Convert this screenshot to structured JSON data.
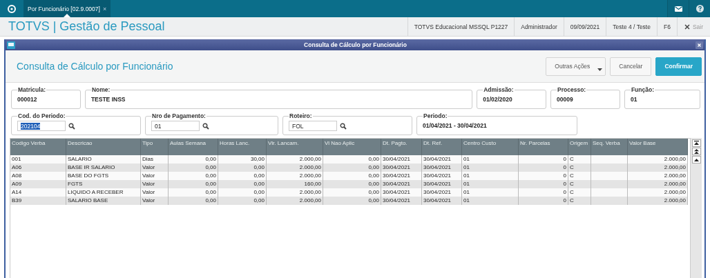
{
  "tabs": [
    {
      "label": "Por Funcionário [02.9.0007]",
      "close": "×",
      "selected": true
    }
  ],
  "app_title": "TOTVS | Gestão de Pessoal",
  "status_items": [
    "TOTVS Educacional MSSQL P1227",
    "Administrador",
    "09/09/2021",
    "Teste 4 / Teste",
    "F6"
  ],
  "exit_label": "Sair",
  "dialog": {
    "title": "Consulta de Cálculo por Funcionário",
    "heading": "Consulta de Cálculo por Funcionário",
    "buttons": [
      {
        "label": "Outras Ações",
        "kind": "menu"
      },
      {
        "label": "Cancelar",
        "kind": "plain"
      },
      {
        "label": "Confirmar",
        "kind": "primary"
      }
    ],
    "fields_row1": [
      {
        "label": "Matricula:",
        "value": "000012",
        "kind": "display"
      },
      {
        "label": "Nome:",
        "value": "TESTE INSS",
        "kind": "display"
      },
      {
        "label": "Admissão:",
        "value": "01/02/2020",
        "kind": "display"
      },
      {
        "label": "Processo:",
        "value": "00009",
        "kind": "display"
      },
      {
        "label": "Função:",
        "value": "01",
        "kind": "display"
      }
    ],
    "fields_row2": [
      {
        "label": "Cod. do Periodo:",
        "value": "202104",
        "kind": "lookup",
        "highlighted": true
      },
      {
        "label": "Nro de Pagamento:",
        "value": "01",
        "kind": "lookup",
        "highlighted": false
      },
      {
        "label": "Roteiro:",
        "value": "FOL",
        "kind": "lookup",
        "highlighted": false
      },
      {
        "label": "Periodo:",
        "value": "01/04/2021 - 30/04/2021",
        "kind": "display"
      }
    ],
    "table": {
      "columns": [
        {
          "label": "Codigo Verba",
          "kind": "text"
        },
        {
          "label": "Descricao",
          "kind": "text"
        },
        {
          "label": "Tipo",
          "kind": "text"
        },
        {
          "label": "Aulas Semana",
          "kind": "number"
        },
        {
          "label": "Horas Lanc.",
          "kind": "number"
        },
        {
          "label": "Vlr. Lancam.",
          "kind": "number"
        },
        {
          "label": "Vl Nao Aplic",
          "kind": "number"
        },
        {
          "label": "Dt. Pagto.",
          "kind": "text"
        },
        {
          "label": "Dt. Ref.",
          "kind": "text"
        },
        {
          "label": "Centro Custo",
          "kind": "text"
        },
        {
          "label": "Nr. Parcelas",
          "kind": "number"
        },
        {
          "label": "Origem",
          "kind": "text"
        },
        {
          "label": "Seq. Verba",
          "kind": "text"
        },
        {
          "label": "Valor Base",
          "kind": "number"
        }
      ],
      "rows": [
        [
          "001",
          "SALARIO",
          "Dias",
          "0,00",
          "30,00",
          "2.000,00",
          "0,00",
          "30/04/2021",
          "30/04/2021",
          "01",
          "0",
          "C",
          "",
          "2.000,00"
        ],
        [
          "A06",
          "BASE IR SALARIO",
          "Valor",
          "0,00",
          "0,00",
          "2.000,00",
          "0,00",
          "30/04/2021",
          "30/04/2021",
          "01",
          "0",
          "C",
          "",
          "2.000,00"
        ],
        [
          "A08",
          "BASE DO FGTS",
          "Valor",
          "0,00",
          "0,00",
          "2.000,00",
          "0,00",
          "30/04/2021",
          "30/04/2021",
          "01",
          "0",
          "C",
          "",
          "2.000,00"
        ],
        [
          "A09",
          "FGTS",
          "Valor",
          "0,00",
          "0,00",
          "160,00",
          "0,00",
          "30/04/2021",
          "30/04/2021",
          "01",
          "0",
          "C",
          "",
          "2.000,00"
        ],
        [
          "A14",
          "LIQUIDO A RECEBER",
          "Valor",
          "0,00",
          "0,00",
          "2.000,00",
          "0,00",
          "30/04/2021",
          "30/04/2021",
          "01",
          "0",
          "C",
          "",
          "2.000,00"
        ],
        [
          "B39",
          "SALARIO BASE",
          "Valor",
          "0,00",
          "0,00",
          "2.000,00",
          "0,00",
          "30/04/2021",
          "30/04/2021",
          "01",
          "0",
          "C",
          "",
          "2.000,00"
        ]
      ]
    }
  }
}
